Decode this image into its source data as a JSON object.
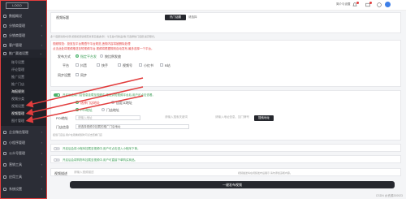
{
  "sidebar": {
    "logo": "LOGO",
    "items": [
      {
        "label": "数据概况",
        "icon": "dashboard-icon"
      },
      {
        "label": "分销商管理",
        "icon": "users-icon"
      },
      {
        "label": "分销商管理",
        "icon": "list-icon"
      },
      {
        "label": "客户管理",
        "icon": "customer-icon"
      },
      {
        "label": "推广渠道设置",
        "icon": "channel-icon"
      }
    ],
    "subitems": [
      "账号设置",
      "评论管理",
      "推广设置",
      "推广门店",
      "海报规则",
      "视频分类",
      "视频设置",
      "视频管理",
      "图片管理"
    ],
    "items_bottom": [
      {
        "label": "企业微信管理",
        "icon": "wechat-icon"
      },
      {
        "label": "小程序管理",
        "icon": "miniapp-icon"
      },
      {
        "label": "公众号管理",
        "icon": "mp-icon"
      },
      {
        "label": "营销工具",
        "icon": "tool-icon"
      },
      {
        "label": "应用工具",
        "icon": "app-icon"
      },
      {
        "label": "系统设置",
        "icon": "settings-icon"
      }
    ]
  },
  "header": {
    "user_label": "简介与设置",
    "icons": [
      "bell-icon",
      "message-icon",
      "help-icon"
    ]
  },
  "form": {
    "video_title_label": "视频标题",
    "hot_button": "热门话题",
    "hot_input": "请选择",
    "hint_top": "多个话题请用#分隔,视频标题请规范并真实描述(例：今日是3月新品)等,可选择热门话题,提高曝光。",
    "rule_red": "视频规范：投放至平台需遵守平台规范,违规内容将被删除处理",
    "rule_red2": "点击此处将视频推送至短视频平台,视频将根据规则自动发布,最多选择一个平台。",
    "publish_type_label": "发布方式",
    "publish_opt1": "指定平台发",
    "publish_opt2": "按比例发放",
    "platform_label": "平台",
    "platforms": [
      "抖音",
      "快手",
      "视频号",
      "小红书",
      "B站"
    ],
    "sync_label": "同步设置",
    "sync_opt": "同步",
    "toggle_row1": "开启后会将门店信息挂载至视频中,推送到短视频平台后,用户可点击查看。",
    "radio_shop1": "选择门店地址",
    "radio_shop2": "自定义地址",
    "radio_mode1": "POI地址",
    "radio_mode2": "门店地址",
    "poi_label": "POI地址",
    "poi_placeholder": "请输入地址",
    "poi_input2": "请输入搜索关键词",
    "poi_input3": "请输入地址信息、如门牌号",
    "search_btn": "搜索地址",
    "store_label": "门店信息",
    "store_value": "请选择视频中挂载的推广门店地址",
    "store_hint": "挂载门店后,用户在观看视频时可点击查看门店",
    "toggle_row2": "开启后会将小程序挂载至视频中,用户可点击进入小程序下单。",
    "toggle_row3": "开启后会将购物车挂载至视频中,用户可直接下单购买商品。",
    "desc_label": "视频描述",
    "desc_placeholder": "请输入视频描述",
    "desc_hint": "视频描述将在视频发布后展示,请勿添加违规内容。",
    "submit": "一键发布视频"
  },
  "footer": "CSDN @资源200923",
  "colors": {
    "sidebar": "#2b2d36",
    "accent": "#49b36a",
    "red": "#e23d3d",
    "dark_button": "#26282e"
  }
}
